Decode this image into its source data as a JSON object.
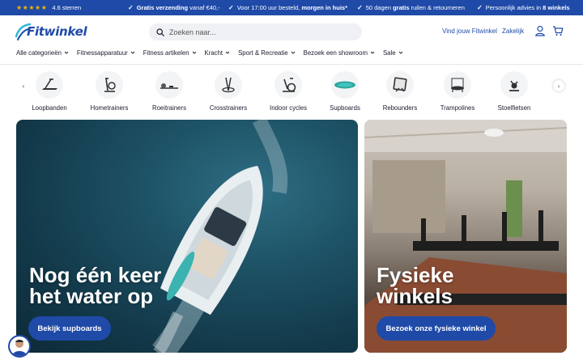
{
  "topbar": {
    "stars": "★★★★★",
    "rating": "4.6 sterren",
    "usps": [
      {
        "pre": "",
        "bold": "Gratis verzending",
        "post": " vanaf €40,-"
      },
      {
        "pre": "Voor 17:00 uur besteld, ",
        "bold": "morgen in huis*",
        "post": ""
      },
      {
        "pre": "50 dagen ",
        "bold": "gratis",
        "post": " ruilen & retourneren"
      },
      {
        "pre": "Persoonlijk advies in ",
        "bold": "8 winkels",
        "post": ""
      }
    ]
  },
  "header": {
    "logo": "Fitwinkel",
    "search_placeholder": "Zoeken naar...",
    "store_link": "Vind jouw Fitwinkel",
    "business_link": "Zakelijk"
  },
  "nav": {
    "items": [
      "Alle categorieën",
      "Fitnessapparatuur",
      "Fitness artikelen",
      "Kracht",
      "Sport & Recreatie",
      "Bezoek een showroom",
      "Sale"
    ]
  },
  "categories": [
    "Loopbanden",
    "Hometrainers",
    "Roeitrainers",
    "Crosstrainers",
    "Indoor cycles",
    "Supboards",
    "Rebounders",
    "Trampolines",
    "Stoelfietsen"
  ],
  "banners": {
    "left": {
      "title_line1": "Nog één keer",
      "title_line2": "het water op",
      "button": "Bekijk supboards"
    },
    "right": {
      "title_line1": "Fysieke",
      "title_line2": "winkels",
      "button": "Bezoek onze fysieke winkel"
    }
  },
  "colors": {
    "brand": "#1f4aa8",
    "star": "#f4b400"
  }
}
